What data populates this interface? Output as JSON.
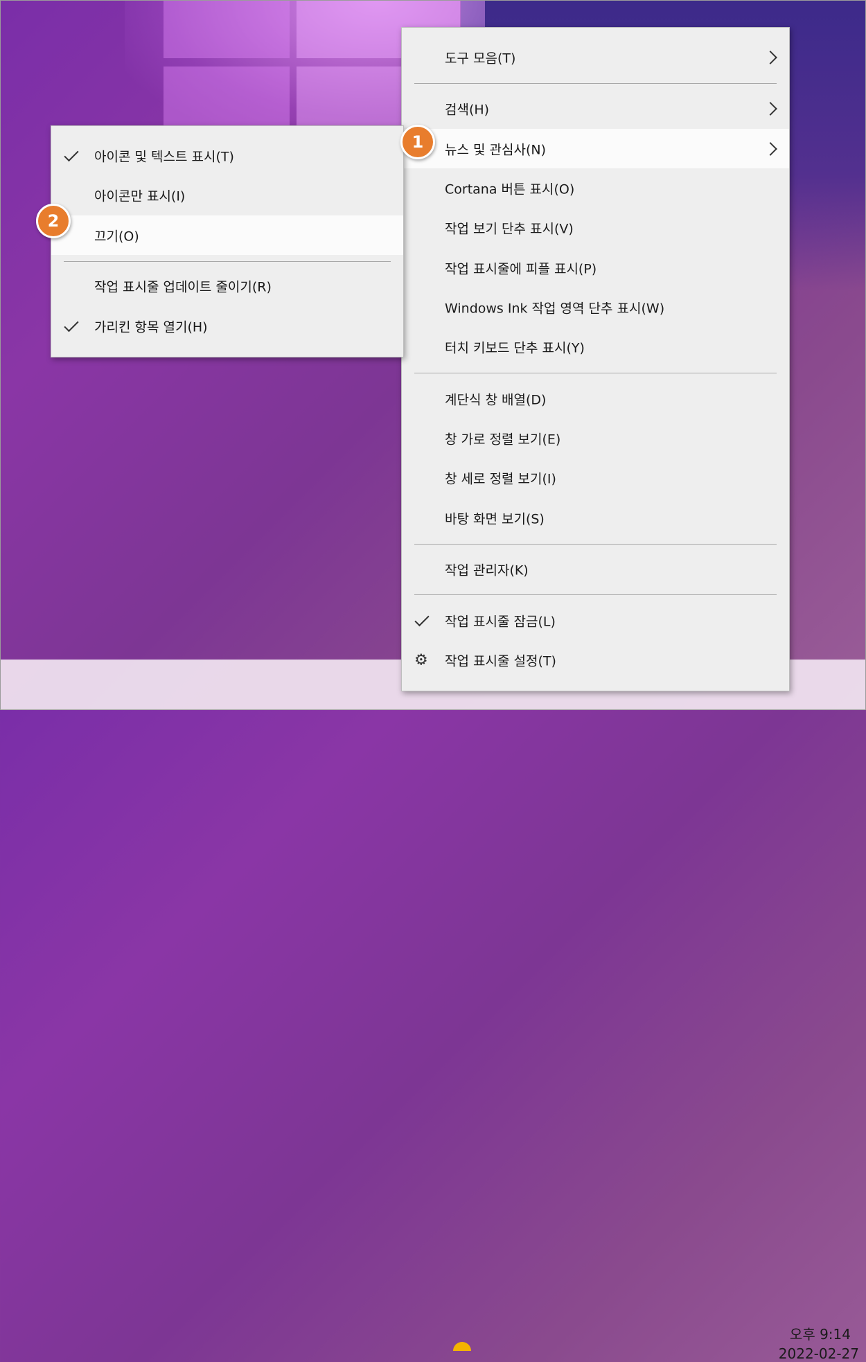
{
  "main_menu": {
    "items": [
      {
        "label": "도구 모음(T)",
        "submenu": true
      },
      {
        "label": "검색(H)",
        "submenu": true
      },
      {
        "label": "뉴스 및 관심사(N)",
        "submenu": true,
        "highlighted": true
      },
      {
        "label": "Cortana 버튼 표시(O)"
      },
      {
        "label": "작업 보기 단추 표시(V)"
      },
      {
        "label": "작업 표시줄에 피플 표시(P)"
      },
      {
        "label": "Windows Ink 작업 영역 단추 표시(W)"
      },
      {
        "label": "터치 키보드 단추 표시(Y)"
      },
      {
        "label": "계단식 창 배열(D)"
      },
      {
        "label": "창 가로 정렬 보기(E)"
      },
      {
        "label": "창 세로 정렬 보기(I)"
      },
      {
        "label": "바탕 화면 보기(S)"
      },
      {
        "label": "작업 관리자(K)"
      },
      {
        "label": "작업 표시줄 잠금(L)",
        "checked": true
      },
      {
        "label": "작업 표시줄 설정(T)",
        "icon": "gear-icon"
      }
    ]
  },
  "sub_menu": {
    "items": [
      {
        "label": "아이콘 및 텍스트 표시(T)",
        "checked": true
      },
      {
        "label": "아이콘만 표시(I)"
      },
      {
        "label": "끄기(O)",
        "highlighted": true
      },
      {
        "label": "작업 표시줄 업데이트 줄이기(R)"
      },
      {
        "label": "가리킨 항목 열기(H)",
        "checked": true
      }
    ]
  },
  "badges": {
    "step1": "1",
    "step2": "2"
  },
  "taskbar": {
    "time": "오후 9:14",
    "date": "2022-02-27"
  },
  "colors": {
    "badge": "#e87d2d",
    "menu_bg": "#eeeeee",
    "highlight": "#fbfbfb"
  }
}
